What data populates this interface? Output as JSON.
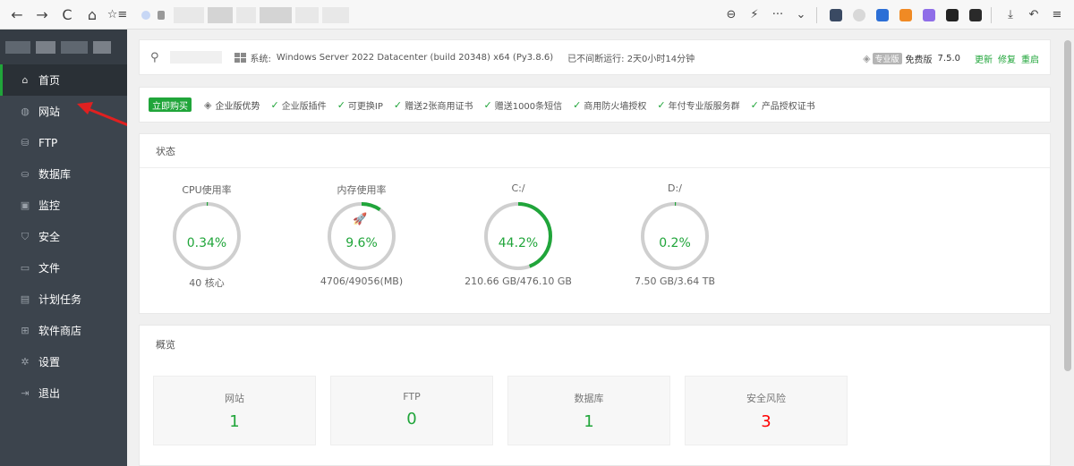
{
  "browser": {
    "nav_icons": [
      "arrow-left-icon",
      "arrow-right-icon",
      "reload-icon",
      "home-icon",
      "bookmark-star-icon"
    ],
    "tools": [
      "zoom-icon",
      "bolt-icon",
      "more-icon",
      "chevron-down-icon"
    ],
    "back_glyph": "←",
    "forward_glyph": "→",
    "reload_glyph": "C",
    "home_glyph": "⌂",
    "fav_glyph": "☆≡",
    "zoom_glyph": "⊖",
    "bolt_glyph": "⚡",
    "more_glyph": "···",
    "chev_glyph": "⌄",
    "download_glyph": "⤓",
    "undo_glyph": "↶",
    "menu_glyph": "≡"
  },
  "sidebar": {
    "items": [
      {
        "label": "首页",
        "icon": "home-icon",
        "glyph": "⌂",
        "active": true
      },
      {
        "label": "网站",
        "icon": "globe-icon",
        "glyph": "◍"
      },
      {
        "label": "FTP",
        "icon": "ftp-icon",
        "glyph": "⛁"
      },
      {
        "label": "数据库",
        "icon": "database-icon",
        "glyph": "⛀"
      },
      {
        "label": "监控",
        "icon": "monitor-icon",
        "glyph": "▣"
      },
      {
        "label": "安全",
        "icon": "shield-icon",
        "glyph": "⛉"
      },
      {
        "label": "文件",
        "icon": "folder-icon",
        "glyph": "▭"
      },
      {
        "label": "计划任务",
        "icon": "calendar-icon",
        "glyph": "▤"
      },
      {
        "label": "软件商店",
        "icon": "apps-icon",
        "glyph": "⊞"
      },
      {
        "label": "设置",
        "icon": "gear-icon",
        "glyph": "✲"
      },
      {
        "label": "退出",
        "icon": "logout-icon",
        "glyph": "⇥"
      }
    ]
  },
  "infobar": {
    "user_glyph": "⚲",
    "system_label": "系统:",
    "system_value": "Windows Server 2022 Datacenter (build 20348) x64 (Py3.8.6)",
    "uptime": "已不间断运行: 2天0小时14分钟",
    "pro_badge": "专业版",
    "free_label": "免费版",
    "version": "7.5.0",
    "update": "更新",
    "repair": "修复",
    "restart": "重启"
  },
  "promo": {
    "buy": "立即购买",
    "enterprise": "企业版优势",
    "features": [
      "企业版插件",
      "可更换IP",
      "赠送2张商用证书",
      "赠送1000条短信",
      "商用防火墙授权",
      "年付专业版服务群",
      "产品授权证书"
    ]
  },
  "status": {
    "title": "状态",
    "gauges": [
      {
        "title": "CPU使用率",
        "value": "0.34%",
        "sub": "40 核心",
        "fraction": 0.0034
      },
      {
        "title": "内存使用率",
        "value": "9.6%",
        "sub": "4706/49056(MB)",
        "fraction": 0.096
      },
      {
        "title": "C:/",
        "value": "44.2%",
        "sub": "210.66 GB/476.10 GB",
        "fraction": 0.442
      },
      {
        "title": "D:/",
        "value": "0.2%",
        "sub": "7.50 GB/3.64 TB",
        "fraction": 0.002
      }
    ]
  },
  "overview": {
    "title": "概览",
    "items": [
      {
        "label": "网站",
        "value": "1",
        "color": "#20a53a"
      },
      {
        "label": "FTP",
        "value": "0",
        "color": "#20a53a"
      },
      {
        "label": "数据库",
        "value": "1",
        "color": "#20a53a"
      },
      {
        "label": "安全风险",
        "value": "3",
        "color": "#ff0000"
      }
    ]
  },
  "colors": {
    "accent": "#20a53a",
    "danger": "#ff0000",
    "sidebar": "#3c444d"
  }
}
